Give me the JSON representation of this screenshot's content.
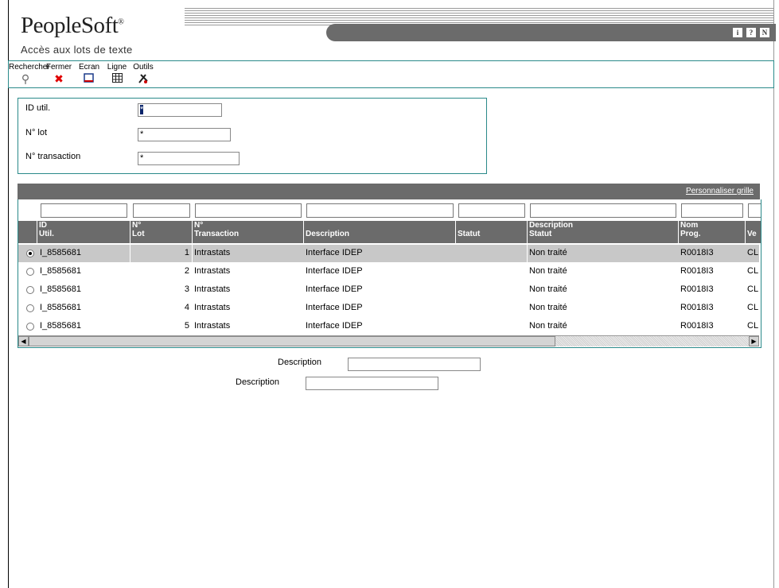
{
  "app": {
    "logo": "PeopleSoft",
    "title": "Accès aux lots de texte"
  },
  "header_icons": [
    "i",
    "?",
    "N"
  ],
  "toolbar": {
    "items": [
      {
        "label": "Rechercher",
        "icon": "find-icon"
      },
      {
        "label": "Fermer",
        "icon": "close-icon"
      },
      {
        "label": "Ecran",
        "icon": "form-icon"
      },
      {
        "label": "Ligne",
        "icon": "row-icon"
      },
      {
        "label": "Outils",
        "icon": "tools-icon"
      }
    ]
  },
  "query": {
    "user_id_label": "ID util.",
    "user_id_value": "*",
    "batch_label": "N° lot",
    "batch_value": "*",
    "transaction_label": "N° transaction",
    "transaction_value": "*"
  },
  "grid": {
    "customize_link": "Personnaliser grille",
    "headers": [
      {
        "line1": "ID",
        "line2": "Util."
      },
      {
        "line1": "N°",
        "line2": "Lot"
      },
      {
        "line1": "N°",
        "line2": "Transaction"
      },
      {
        "line1": "",
        "line2": "Description"
      },
      {
        "line1": "",
        "line2": "Statut"
      },
      {
        "line1": "Description",
        "line2": "Statut"
      },
      {
        "line1": "Nom",
        "line2": "Prog."
      },
      {
        "line1": "",
        "line2": "Ve"
      }
    ],
    "rows": [
      {
        "user": "I_8585681",
        "lot": "1",
        "transaction": "Intrastats",
        "description": "Interface IDEP",
        "status": "",
        "status_desc": "Non traité",
        "program": "R0018I3",
        "ver": "CL"
      },
      {
        "user": "I_8585681",
        "lot": "2",
        "transaction": "Intrastats",
        "description": "Interface IDEP",
        "status": "",
        "status_desc": "Non traité",
        "program": "R0018I3",
        "ver": "CL"
      },
      {
        "user": "I_8585681",
        "lot": "3",
        "transaction": "Intrastats",
        "description": "Interface IDEP",
        "status": "",
        "status_desc": "Non traité",
        "program": "R0018I3",
        "ver": "CL"
      },
      {
        "user": "I_8585681",
        "lot": "4",
        "transaction": "Intrastats",
        "description": "Interface IDEP",
        "status": "",
        "status_desc": "Non traité",
        "program": "R0018I3",
        "ver": "CL"
      },
      {
        "user": "I_8585681",
        "lot": "5",
        "transaction": "Intrastats",
        "description": "Interface IDEP",
        "status": "",
        "status_desc": "Non traité",
        "program": "R0018I3",
        "ver": "CL"
      }
    ]
  },
  "footer": {
    "description1_label": "Description",
    "description2_label": "Description"
  }
}
